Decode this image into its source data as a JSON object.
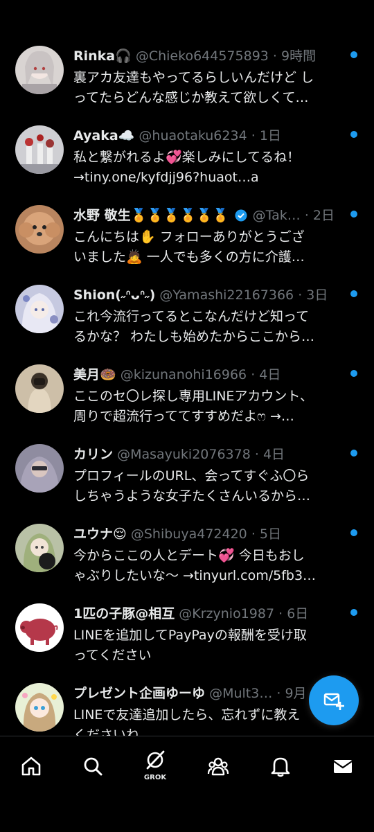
{
  "notifications": [
    {
      "name": "Rinka🎧",
      "handle": "@Chieko644575893",
      "time": "9時間",
      "line1": "裏アカ友達もやってるらしいんだけど し",
      "line2": "ってたらどんな感じか教えて欲しくて…"
    },
    {
      "name": "Ayaka☁️",
      "handle": "@huaotaku6234",
      "time": "1日",
      "line1": "私と繋がれるよ💞楽しみにしてるね！",
      "line2": "→tiny.one/kyfdjj96?huaot…a"
    },
    {
      "name": "水野 敬生🏅🏅🏅🏅🏅🏅",
      "handle": "@Tak…",
      "time": "2日",
      "line1": "こんにちは✋ フォローありがとうござ",
      "line2": "いました🙇 一人でも多くの方に介護…"
    },
    {
      "name": "Shion(˶ᐢᴗᐢ˶)",
      "handle": "@Yamashi22167366",
      "time": "3日",
      "line1": "これ今流行ってるとこなんだけど知って",
      "line2": "るかな？ わたしも始めたからここから…"
    },
    {
      "name": "美月🍩",
      "handle": "@kizunanohi16966",
      "time": "4日",
      "line1": "ここのセ〇レ探し専用LINEアカウント、",
      "line2": "周りで超流行っててすすめだよෆ →…"
    },
    {
      "name": "カリン",
      "handle": "@Masayuki2076378",
      "time": "4日",
      "line1": "プロフィールのURL、会ってすぐふ〇ら",
      "line2": "しちゃうような女子たくさんいるから…"
    },
    {
      "name": "ユウナ😌",
      "handle": "@Shibuya472420",
      "time": "5日",
      "line1": "今からここの人とデート💞 今日もおし",
      "line2": "ゃぶりしたいな〜 →tinyurl.com/5fb3…"
    },
    {
      "name": "1匹の子豚@相互",
      "handle": "@Krzynio1987",
      "time": "6日",
      "line1": "LINEを追加してPayPayの報酬を受け取",
      "line2": "ってください"
    },
    {
      "name": "プレゼント企画ゆーゆ",
      "handle": "@Mult3…",
      "time": "9月",
      "line1": "LINEで友達追加したら、忘れずに教え",
      "line2": "くださいね"
    }
  ],
  "bottom_nav": {
    "grok_label": "GROK",
    "icons": [
      "home-icon",
      "search-icon",
      "grok-icon",
      "communities-icon",
      "notifications-icon",
      "messages-icon"
    ]
  },
  "fab": {
    "icon": "new-message-icon"
  },
  "colors": {
    "background": "#000000",
    "accent": "#1d9bf0",
    "text": "#e7e9ea",
    "muted": "#71767b"
  }
}
